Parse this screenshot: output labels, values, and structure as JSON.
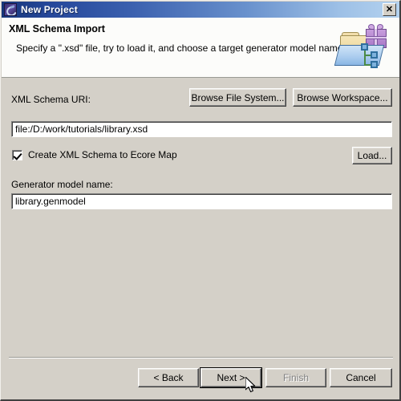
{
  "window": {
    "title": "New Project",
    "icon": "eclipse-wizard-icon",
    "close_label": "✕"
  },
  "header": {
    "title": "XML Schema Import",
    "description": "Specify a \".xsd\" file, try to load it, and choose a target generator model name",
    "banner_icon": "folder-gift-model-icon"
  },
  "form": {
    "uri_label": "XML Schema URI:",
    "browse_file_system_label": "Browse File System...",
    "browse_workspace_label": "Browse Workspace...",
    "uri_value": "file:/D:/work/tutorials/library.xsd",
    "uri_placeholder": "",
    "checkbox_label": "Create XML Schema to Ecore Map",
    "checkbox_checked": true,
    "load_label": "Load...",
    "genmodel_label": "Generator model name:",
    "genmodel_value": "library.genmodel",
    "genmodel_placeholder": ""
  },
  "buttons": {
    "back": "< Back",
    "next": "Next >",
    "finish": "Finish",
    "cancel": "Cancel",
    "finish_disabled": true,
    "default_button": "Next >"
  },
  "colors": {
    "dialog_background": "#d4d0c8",
    "header_background": "#fcfcfa",
    "titlebar_left": "#16367a",
    "titlebar_right": "#b4d2ef",
    "field_background": "#ffffff",
    "disabled_text": "#808080"
  }
}
